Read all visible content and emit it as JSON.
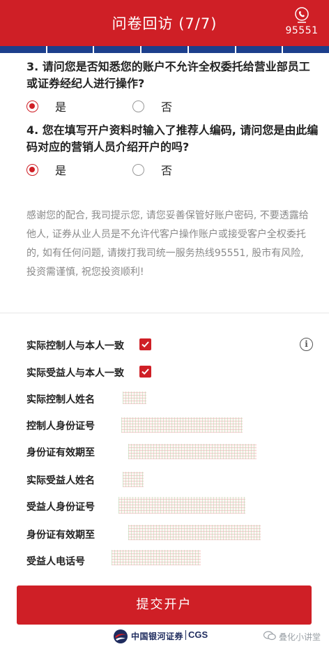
{
  "header": {
    "title": "问卷回访 (7/7)",
    "hotline": "95551",
    "hotline_icon": "phone-handset-icon"
  },
  "progress": {
    "current": 7,
    "total": 7
  },
  "questions": [
    {
      "text": "3. 请问您是否知悉您的账户不允许全权委托给营业部员工或证券经纪人进行操作?",
      "options": [
        "是",
        "否"
      ],
      "selected": "是"
    },
    {
      "text": "4. 您在填写开户资料时输入了推荐人编码, 请问您是由此编码对应的营销人员介绍开户的吗?",
      "options": [
        "是",
        "否"
      ],
      "selected": "是"
    }
  ],
  "notice": "感谢您的配合, 我司提示您, 请您妥善保管好账户密码, 不要透露给他人, 证券从业人员是不允许代客户操作账户或接受客户全权委托的, 如有任何问题, 请拨打我司统一服务热线95551, 股市有风险, 投资需谨慎, 祝您投资顺利!",
  "form": {
    "checks": [
      {
        "label": "实际控制人与本人一致",
        "checked": true
      },
      {
        "label": "实际受益人与本人一致",
        "checked": true
      }
    ],
    "fields": [
      {
        "label": "实际控制人姓名"
      },
      {
        "label": "控制人身份证号"
      },
      {
        "label": "身份证有效期至"
      },
      {
        "label": "实际受益人姓名"
      },
      {
        "label": "受益人身份证号"
      },
      {
        "label": "身份证有效期至"
      },
      {
        "label": "受益人电话号"
      }
    ],
    "info_icon": "info-icon"
  },
  "submit_label": "提交开户",
  "footer": {
    "brand_cn": "中国银河证券",
    "brand_en": "CGS",
    "watermark": "叠化小讲堂"
  },
  "colors": {
    "primary_red": "#cf1f26",
    "progress_blue": "#1c3f8c",
    "muted_text": "#8a8a8a"
  }
}
